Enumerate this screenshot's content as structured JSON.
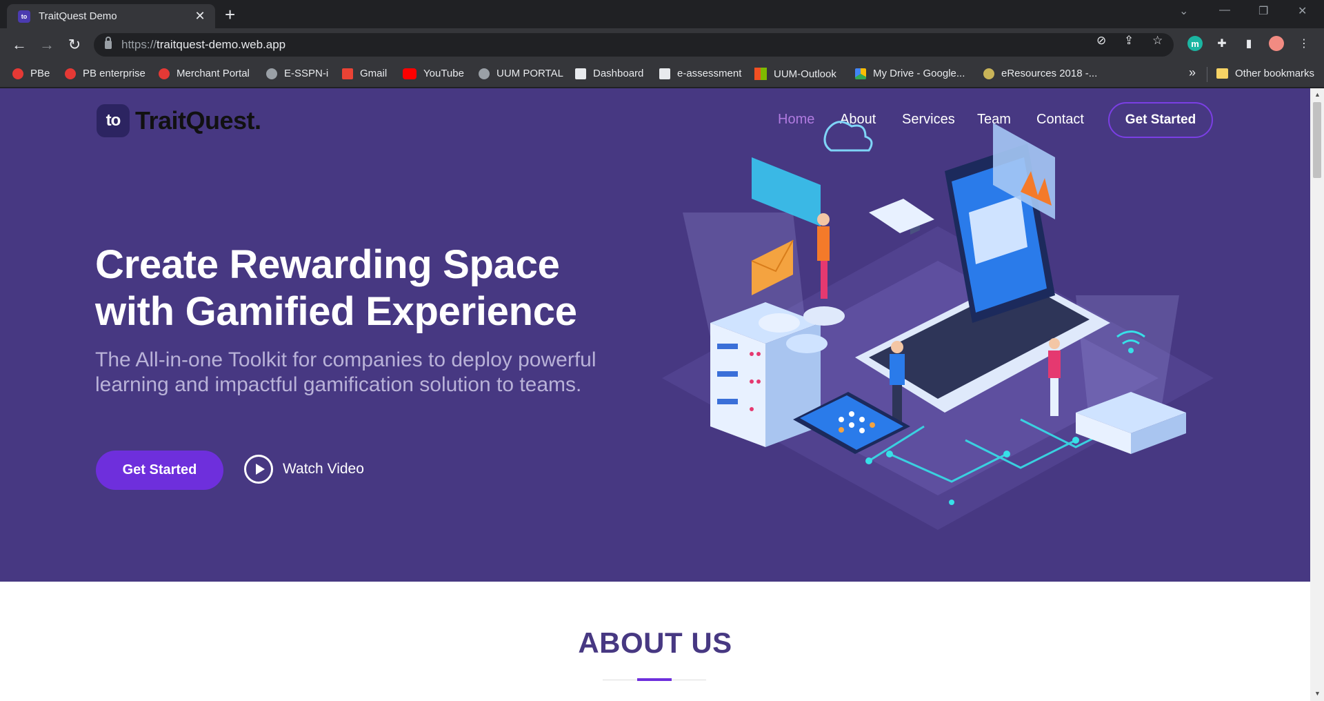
{
  "browser": {
    "tab_title": "TraitQuest Demo",
    "tab_favicon_text": "to",
    "url_scheme": "https://",
    "url_host": "traitquest-demo.web.app",
    "bookmarks": [
      {
        "label": "PBe",
        "icon": "pbe-icon",
        "color": "#e53935"
      },
      {
        "label": "PB enterprise",
        "icon": "pb-enterprise-icon",
        "color": "#e53935"
      },
      {
        "label": "Merchant Portal",
        "icon": "merchant-portal-icon",
        "color": "#e53935"
      },
      {
        "label": "E-SSPN-i",
        "icon": "globe-icon",
        "color": "#9aa0a6"
      },
      {
        "label": "Gmail",
        "icon": "gmail-icon",
        "color": "#ea4335"
      },
      {
        "label": "YouTube",
        "icon": "youtube-icon",
        "color": "#ff0000"
      },
      {
        "label": "UUM PORTAL",
        "icon": "globe-icon",
        "color": "#9aa0a6"
      },
      {
        "label": "Dashboard",
        "icon": "moodle-icon",
        "color": "#e8eaed"
      },
      {
        "label": "e-assessment",
        "icon": "moodle-icon",
        "color": "#e8eaed"
      },
      {
        "label": "UUM-Outlook",
        "icon": "microsoft-icon",
        "color": "#f25022"
      },
      {
        "label": "My Drive - Google...",
        "icon": "drive-icon",
        "color": "#fbbc04"
      },
      {
        "label": "eResources 2018 -...",
        "icon": "eresources-icon",
        "color": "#c9b458"
      }
    ],
    "overflow_label": "»",
    "other_bookmarks": "Other bookmarks"
  },
  "site": {
    "logo_badge": "to",
    "logo_text": "TraitQuest.",
    "nav": [
      {
        "label": "Home",
        "active": true
      },
      {
        "label": "About",
        "active": false
      },
      {
        "label": "Services",
        "active": false
      },
      {
        "label": "Team",
        "active": false
      },
      {
        "label": "Contact",
        "active": false
      }
    ],
    "nav_cta": "Get Started",
    "hero": {
      "title_line1": "Create Rewarding Space",
      "title_line2": "with Gamified Experience",
      "subtitle_line1": "The All-in-one Toolkit for companies to deploy powerful",
      "subtitle_line2": "learning and impactful gamification solution to teams.",
      "cta": "Get Started",
      "video_label": "Watch Video"
    },
    "about_title": "ABOUT US"
  },
  "colors": {
    "hero_bg": "#473882",
    "accent": "#6e2fdc",
    "nav_active": "#b07be0"
  }
}
